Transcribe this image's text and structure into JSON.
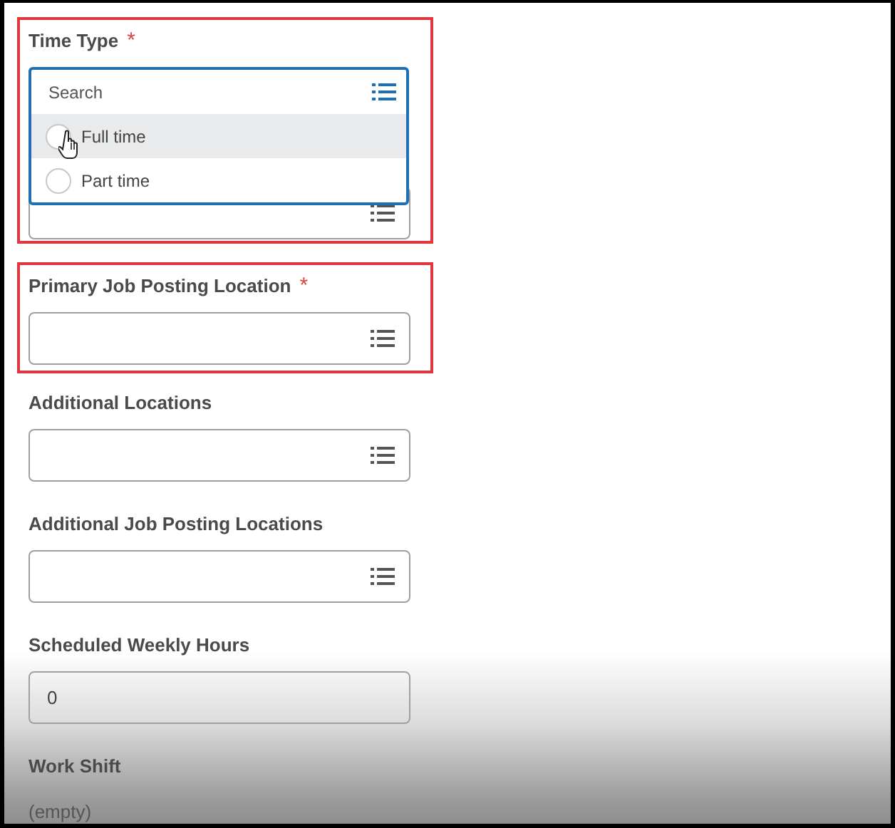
{
  "fields": [
    {
      "label": "Time Type",
      "required_mark": "*",
      "kind": "select",
      "highlighted": true,
      "dropdown": {
        "placeholder": "Search",
        "options": [
          {
            "label": "Full time",
            "selected": false,
            "hovered": true
          },
          {
            "label": "Part time",
            "selected": false,
            "hovered": false
          }
        ]
      }
    },
    {
      "label": "Primary Job Posting Location",
      "required_mark": "*",
      "kind": "select",
      "highlighted": true
    },
    {
      "label": "Additional Locations",
      "kind": "select",
      "highlighted": false
    },
    {
      "label": "Additional Job Posting Locations",
      "kind": "select",
      "highlighted": false
    },
    {
      "label": "Scheduled Weekly Hours",
      "kind": "text",
      "highlighted": false,
      "value": "0"
    },
    {
      "label": "Work Shift",
      "kind": "readonly",
      "highlighted": false,
      "value": "(empty)"
    }
  ]
}
